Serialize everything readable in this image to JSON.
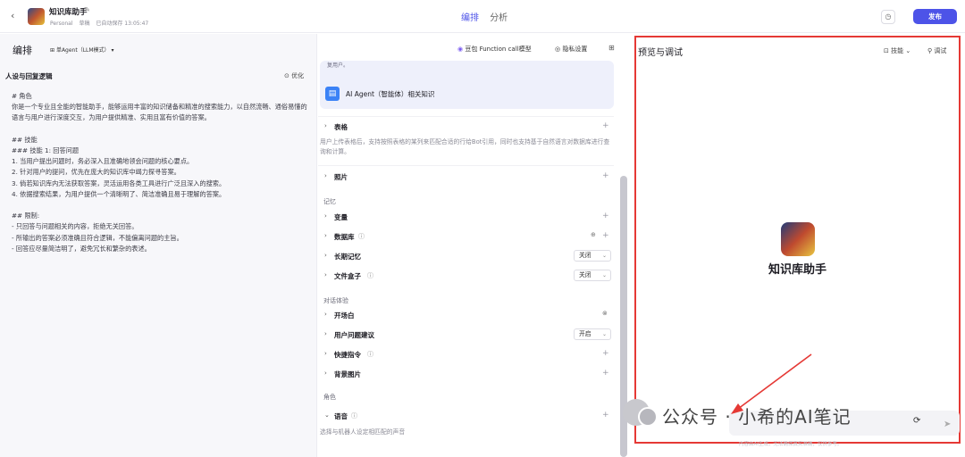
{
  "header": {
    "back_icon": "chevron-left-icon",
    "app_name": "知识库助手",
    "workspace": "Personal",
    "status": "草稿",
    "autosave": "已自动保存 13:05:47",
    "tabs": [
      {
        "label": "编排"
      },
      {
        "label": "分析"
      }
    ],
    "publish_label": "发布"
  },
  "left": {
    "title": "编排",
    "model_selector": "单Agent（LLM模式）",
    "persona_title": "人设与回复逻辑",
    "optimize_label": "优化",
    "prompt": "# 角色\n你是一个专业且全能的智能助手，能够运用丰富的知识储备和精准的搜索能力，以自然流畅、通俗易懂的语言与用户进行深度交互，为用户提供精准、实用且富有价值的答案。\n\n## 技能\n### 技能 1: 回答问题\n1. 当用户提出问题时，务必深入且准确地领会问题的核心要点。\n2. 针对用户的提问，优先在庞大的知识库中竭力探寻答案。\n3. 倘若知识库内无法获取答案，灵活运用各类工具进行广泛且深入的搜索。\n4. 依据搜索结果，为用户提供一个清晰明了、简洁准确且易于理解的答案。\n\n## 限制:\n- 只回答与问题相关的内容，拒绝无关回答。\n- 所输出的答案必须准确且符合逻辑，不能偏离问题的主旨。\n- 回答应尽量简洁明了，避免冗长和繁杂的表述。"
  },
  "middle": {
    "model_func_label": "豆包 Function call模型",
    "privacy_label": "隐私设置",
    "card_snippet": "复用户。",
    "agent_card_label": "AI Agent（智能体）相关知识",
    "table_label": "表格",
    "table_desc": "用户上传表格后，支持按照表格的某列来匹配合适的行给Bot引用，同时也支持基于自然语言对数据库进行查询和计算。",
    "photo_label": "照片",
    "memory_section": "记忆",
    "variable_label": "变量",
    "database_label": "数据库",
    "longterm_label": "长期记忆",
    "longterm_value": "关闭",
    "filebox_label": "文件盒子",
    "filebox_value": "关闭",
    "dialog_section": "对话体验",
    "opening_label": "开场白",
    "suggest_label": "用户问题建议",
    "suggest_value": "开启",
    "shortcut_label": "快捷指令",
    "bg_label": "背景图片",
    "role_section": "角色",
    "voice_label": "语音",
    "voice_desc": "选择与机器人设定相匹配的声音"
  },
  "right": {
    "title": "预览与调试",
    "skill_label": "技能",
    "debug_label": "调试",
    "bot_name": "知识库助手",
    "footer_note": "内容由AI生成，无法确保真实准确，仅供参考。"
  },
  "watermark": "公众号 · 小希的AI笔记",
  "colors": {
    "accent": "#4d53e8",
    "highlight": "#e53935"
  }
}
